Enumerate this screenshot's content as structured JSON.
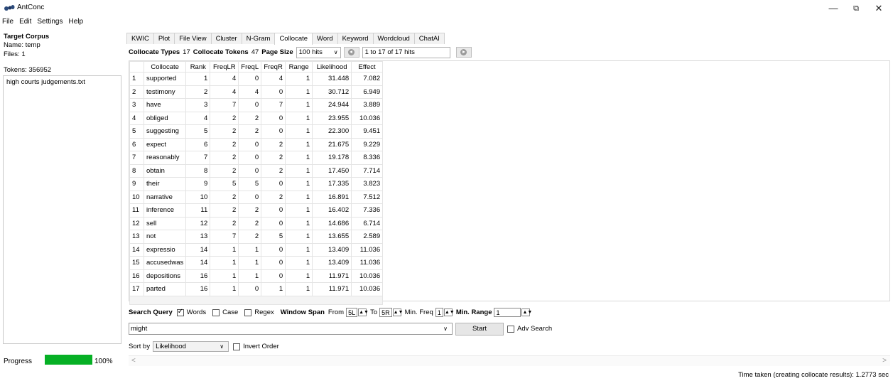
{
  "window": {
    "title": "AntConc",
    "minimize_glyph": "—",
    "restore_glyph": "⧉",
    "close_glyph": "✕"
  },
  "menu": [
    "File",
    "Edit",
    "Settings",
    "Help"
  ],
  "left_panel": {
    "heading": "Target Corpus",
    "name": "Name:  temp",
    "files": "Files:   1",
    "tokens": "Tokens: 356952",
    "file_list": [
      "high courts judgements.txt"
    ],
    "progress_label": "Progress",
    "progress_value": "100%",
    "progress_fraction": 1.0
  },
  "tabs": [
    "KWIC",
    "Plot",
    "File View",
    "Cluster",
    "N-Gram",
    "Collocate",
    "Word",
    "Keyword",
    "Wordcloud",
    "ChatAI"
  ],
  "active_tab": "Collocate",
  "info": {
    "types_label": "Collocate Types",
    "types_value": "17",
    "tokens_label": "Collocate Tokens",
    "tokens_value": "47",
    "page_size_label": "Page Size",
    "page_size_value": "100 hits",
    "hits_range": "1 to 17 of 17 hits"
  },
  "table": {
    "headers": [
      "",
      "Collocate",
      "Rank",
      "FreqLR",
      "FreqL",
      "FreqR",
      "Range",
      "Likelihood",
      "Effect"
    ],
    "rows": [
      [
        "1",
        "supported",
        "1",
        "4",
        "0",
        "4",
        "1",
        "31.448",
        "7.082"
      ],
      [
        "2",
        "testimony",
        "2",
        "4",
        "4",
        "0",
        "1",
        "30.712",
        "6.949"
      ],
      [
        "3",
        "have",
        "3",
        "7",
        "0",
        "7",
        "1",
        "24.944",
        "3.889"
      ],
      [
        "4",
        "obliged",
        "4",
        "2",
        "2",
        "0",
        "1",
        "23.955",
        "10.036"
      ],
      [
        "5",
        "suggesting",
        "5",
        "2",
        "2",
        "0",
        "1",
        "22.300",
        "9.451"
      ],
      [
        "6",
        "expect",
        "6",
        "2",
        "0",
        "2",
        "1",
        "21.675",
        "9.229"
      ],
      [
        "7",
        "reasonably",
        "7",
        "2",
        "0",
        "2",
        "1",
        "19.178",
        "8.336"
      ],
      [
        "8",
        "obtain",
        "8",
        "2",
        "0",
        "2",
        "1",
        "17.450",
        "7.714"
      ],
      [
        "9",
        "their",
        "9",
        "5",
        "5",
        "0",
        "1",
        "17.335",
        "3.823"
      ],
      [
        "10",
        "narrative",
        "10",
        "2",
        "0",
        "2",
        "1",
        "16.891",
        "7.512"
      ],
      [
        "11",
        "inference",
        "11",
        "2",
        "2",
        "0",
        "1",
        "16.402",
        "7.336"
      ],
      [
        "12",
        "sell",
        "12",
        "2",
        "2",
        "0",
        "1",
        "14.686",
        "6.714"
      ],
      [
        "13",
        "not",
        "13",
        "7",
        "2",
        "5",
        "1",
        "13.655",
        "2.589"
      ],
      [
        "14",
        "expressio",
        "14",
        "1",
        "1",
        "0",
        "1",
        "13.409",
        "11.036"
      ],
      [
        "15",
        "accusedwas",
        "14",
        "1",
        "1",
        "0",
        "1",
        "13.409",
        "11.036"
      ],
      [
        "16",
        "depositions",
        "16",
        "1",
        "1",
        "0",
        "1",
        "11.971",
        "10.036"
      ],
      [
        "17",
        "parted",
        "16",
        "1",
        "0",
        "1",
        "1",
        "11.971",
        "10.036"
      ]
    ]
  },
  "search": {
    "label": "Search Query",
    "words_label": "Words",
    "words_checked": true,
    "case_label": "Case",
    "case_checked": false,
    "regex_label": "Regex",
    "regex_checked": false,
    "window_span_label": "Window Span",
    "from_label": "From",
    "from_value": "5L",
    "to_label": "To",
    "to_value": "5R",
    "min_freq_label": "Min. Freq",
    "min_freq_value": "1",
    "min_range_label": "Min. Range",
    "min_range_value": "1",
    "query": "might",
    "start_label": "Start",
    "adv_search_label": "Adv Search",
    "adv_search_checked": false
  },
  "sort": {
    "label": "Sort by",
    "value": "Likelihood",
    "invert_label": "Invert Order",
    "invert_checked": false
  },
  "status": "Time taken (creating collocate results):  1.2773 sec"
}
